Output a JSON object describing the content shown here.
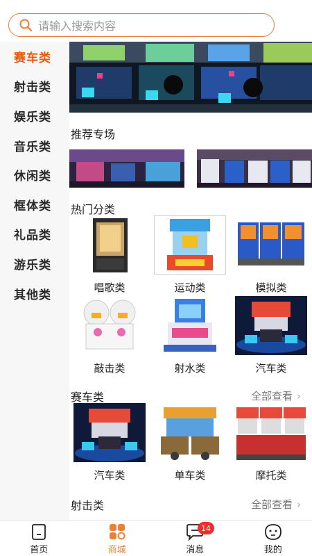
{
  "search": {
    "placeholder": "请输入搜索内容"
  },
  "sidebar": {
    "items": [
      {
        "label": "赛车类",
        "active": true
      },
      {
        "label": "射击类"
      },
      {
        "label": "娱乐类"
      },
      {
        "label": "音乐类"
      },
      {
        "label": "休闲类"
      },
      {
        "label": "框体类"
      },
      {
        "label": "礼品类"
      },
      {
        "label": "游乐类"
      },
      {
        "label": "其他类"
      }
    ]
  },
  "main": {
    "recommend_title": "推荐专场",
    "hot_title": "热门分类",
    "hot_categories": [
      {
        "label": "唱歌类"
      },
      {
        "label": "运动类"
      },
      {
        "label": "模拟类"
      },
      {
        "label": "敲击类"
      },
      {
        "label": "射水类"
      },
      {
        "label": "汽车类"
      }
    ],
    "racing": {
      "title": "赛车类",
      "more": "全部查看",
      "items": [
        {
          "label": "汽车类"
        },
        {
          "label": "单车类"
        },
        {
          "label": "摩托类"
        }
      ]
    },
    "shooting": {
      "title": "射击类",
      "more": "全部查看"
    }
  },
  "tabbar": {
    "items": [
      {
        "label": "首页"
      },
      {
        "label": "商城",
        "active": true
      },
      {
        "label": "消息",
        "badge": "14"
      },
      {
        "label": "我的"
      }
    ]
  },
  "colors": {
    "accent": "#e8813a",
    "active_red": "#e85a12",
    "badge": "#ee2d2d"
  }
}
